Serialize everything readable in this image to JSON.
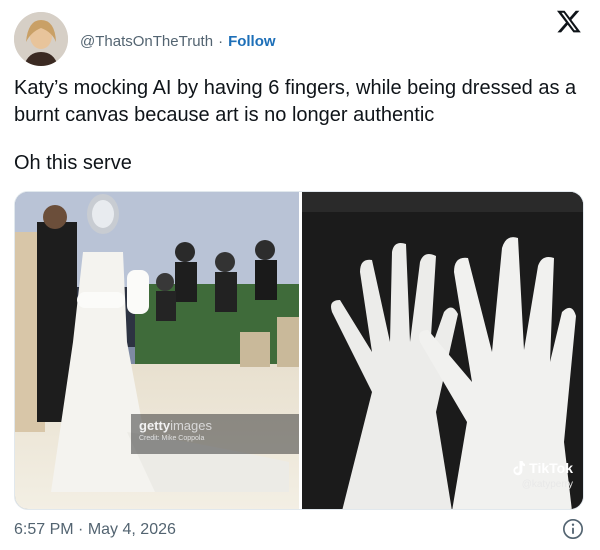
{
  "post": {
    "handle": "@ThatsOnTheTruth",
    "separator": "·",
    "follow_label": "Follow",
    "text_line": "Katy’s mocking AI by having 6 fingers, while being dressed as a burnt canvas because art is no longer authentic",
    "text_line2": "Oh this serve",
    "time": "6:57 PM",
    "date": "May 4, 2026"
  },
  "media": {
    "left": {
      "watermark_brand": "getty",
      "watermark_brand_light": "images",
      "watermark_credit": "Credit: Mike Coppola"
    },
    "right": {
      "brand": "TikTok",
      "user": "@katyperry"
    }
  },
  "icons": {
    "platform": "x-logo-icon",
    "info": "info-icon",
    "tiktok": "tiktok-logo-icon"
  },
  "colors": {
    "link": "#1d6fb8",
    "secondary_text": "#536471",
    "text": "#0f1419"
  }
}
